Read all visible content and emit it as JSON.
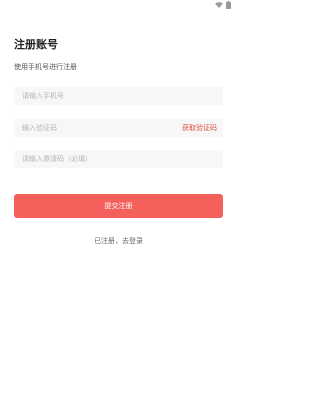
{
  "status_bar": {
    "icons": [
      "wifi-icon",
      "battery-icon"
    ]
  },
  "header": {
    "title": "注册账号",
    "subtitle": "使用手机号进行注册"
  },
  "form": {
    "phone": {
      "placeholder": "请输入手机号",
      "value": ""
    },
    "code": {
      "placeholder": "输入验证码",
      "value": "",
      "get_code_label": "获取验证码"
    },
    "invite": {
      "placeholder": "请输入邀请码（必填）",
      "value": ""
    },
    "submit_label": "提交注册"
  },
  "footer": {
    "login_link": "已注册，去登录"
  },
  "colors": {
    "accent": "#f4605c",
    "link": "#e0513f",
    "field_bg": "#f7f7f7"
  }
}
